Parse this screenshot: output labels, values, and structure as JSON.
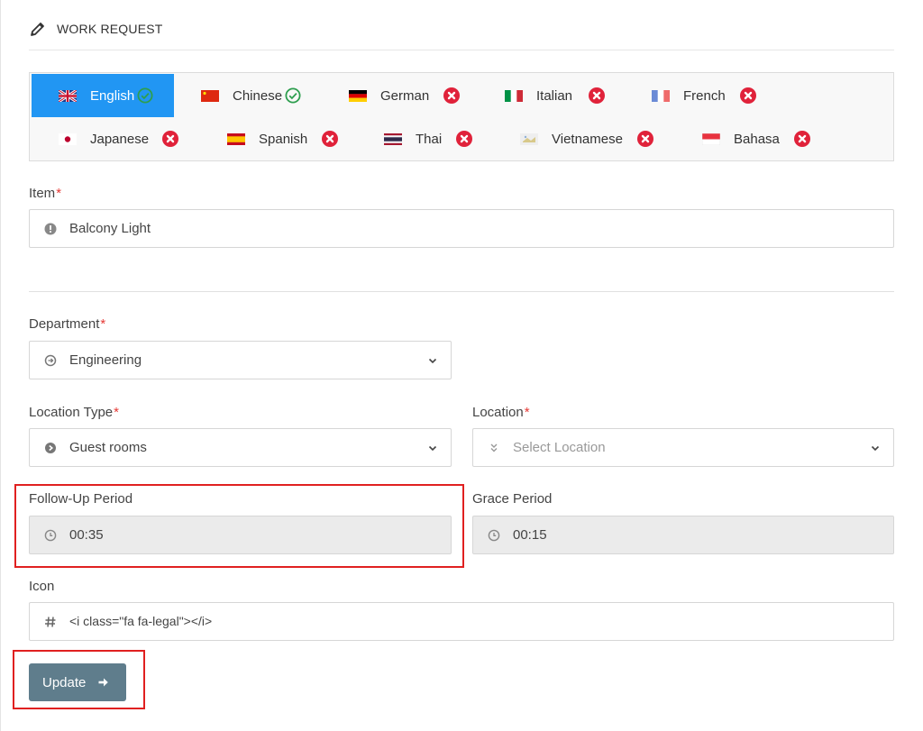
{
  "header": {
    "title": "WORK REQUEST",
    "icon": "pencil-icon"
  },
  "languages": [
    {
      "name": "English",
      "status": "ok",
      "active": true
    },
    {
      "name": "Chinese",
      "status": "ok",
      "active": false
    },
    {
      "name": "German",
      "status": "missing",
      "active": false
    },
    {
      "name": "Italian",
      "status": "missing",
      "active": false
    },
    {
      "name": "French",
      "status": "missing",
      "active": false
    },
    {
      "name": "Japanese",
      "status": "missing",
      "active": false
    },
    {
      "name": "Spanish",
      "status": "missing",
      "active": false
    },
    {
      "name": "Thai",
      "status": "missing",
      "active": false
    },
    {
      "name": "Vietnamese",
      "status": "missing",
      "active": false
    },
    {
      "name": "Bahasa",
      "status": "missing",
      "active": false
    }
  ],
  "form": {
    "item": {
      "label": "Item",
      "required_mark": "*",
      "value": "Balcony Light",
      "icon": "info-icon"
    },
    "department": {
      "label": "Department",
      "required_mark": "*",
      "value": "Engineering",
      "icon": "circle-arrow-icon"
    },
    "location_type": {
      "label": "Location Type",
      "required_mark": "*",
      "value": "Guest rooms",
      "icon": "circle-play-icon"
    },
    "location": {
      "label": "Location",
      "required_mark": "*",
      "placeholder": "Select Location",
      "icon": "double-chevron-icon"
    },
    "follow_up": {
      "label": "Follow-Up Period",
      "value": "00:35",
      "icon": "clock-icon"
    },
    "grace": {
      "label": "Grace Period",
      "value": "00:15",
      "icon": "clock-icon"
    },
    "icon_field": {
      "label": "Icon",
      "value": "<i class=\"fa fa-legal\"></i>",
      "icon": "hash-icon"
    }
  },
  "actions": {
    "update_label": "Update"
  },
  "colors": {
    "active_tab": "#2196f3",
    "ok": "#2e9e4f",
    "missing": "#e0223a",
    "button": "#5f7d8c",
    "highlight": "#e02020"
  }
}
